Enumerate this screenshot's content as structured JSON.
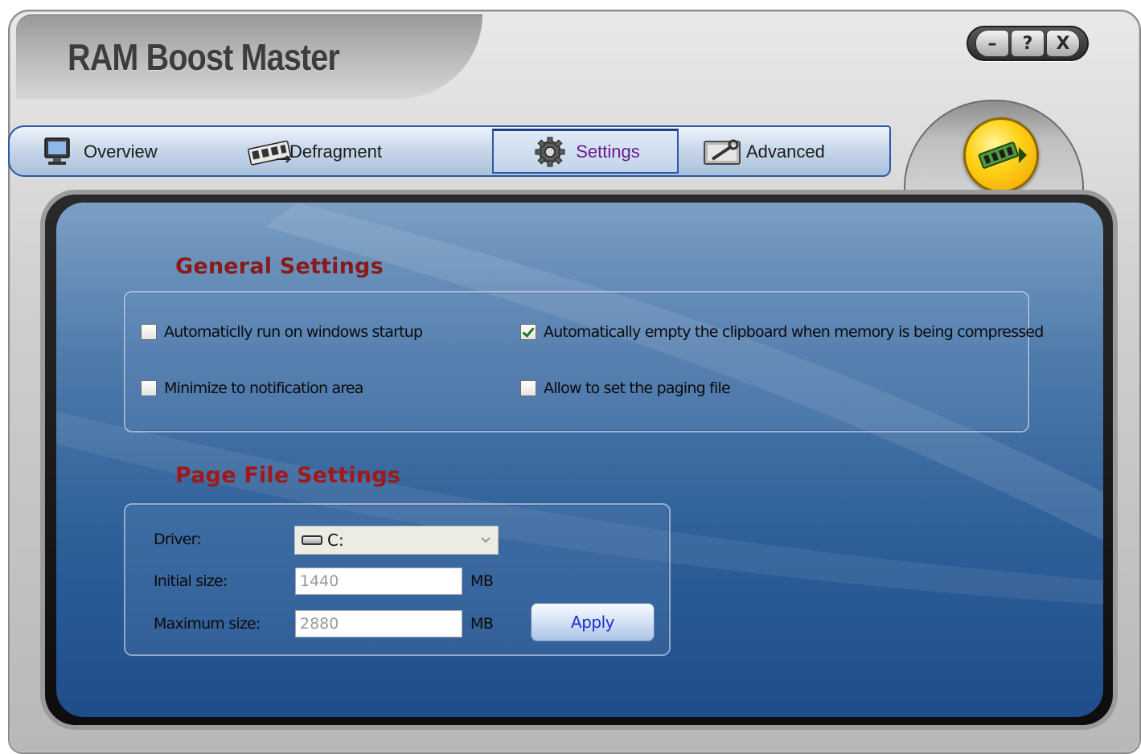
{
  "app": {
    "title": "RAM Boost Master"
  },
  "window_controls": {
    "minimize": "–",
    "help": "?",
    "close": "X"
  },
  "tabs": [
    {
      "label": "Overview",
      "icon": "monitor-icon"
    },
    {
      "label": "Defragment",
      "icon": "memory-chips-icon"
    },
    {
      "label": "Settings",
      "icon": "gear-icon",
      "active": true
    },
    {
      "label": "Advanced",
      "icon": "wrench-tool-icon"
    }
  ],
  "go_button": {
    "icon": "memory-chip-go-icon"
  },
  "general": {
    "heading": "General Settings",
    "options": [
      {
        "label": "Automaticlly run on windows startup",
        "checked": false
      },
      {
        "label": "Minimize to notification area",
        "checked": false
      },
      {
        "label": "Automatically empty the clipboard when memory is being compressed",
        "checked": true
      },
      {
        "label": "Allow to set the paging file",
        "checked": false
      }
    ]
  },
  "pagefile": {
    "heading": "Page File Settings",
    "driver_label": "Driver:",
    "driver_value": "C:",
    "initial_label": "Initial size:",
    "initial_value": "1440",
    "maximum_label": "Maximum size:",
    "maximum_value": "2880",
    "unit": "MB",
    "apply_label": "Apply"
  },
  "colors": {
    "heading_red": "#8a1a1a",
    "tab_border_blue": "#2c58a6",
    "apply_text_blue": "#1b2fd0",
    "panel_blue": "#2e5f99",
    "check_green": "#1e7a1e"
  }
}
